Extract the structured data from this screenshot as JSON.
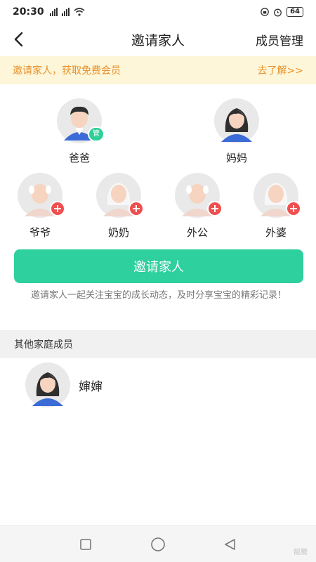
{
  "status_bar": {
    "time": "20:30",
    "battery": "64"
  },
  "header": {
    "title": "邀请家人",
    "right_action": "成员管理"
  },
  "promo": {
    "text": "邀请家人，获取免费会员",
    "link": "去了解>>"
  },
  "family_top": [
    {
      "name": "爸爸",
      "role": "father",
      "badge": "管"
    },
    {
      "name": "妈妈",
      "role": "mother"
    }
  ],
  "family_grand": [
    {
      "name": "爷爷",
      "role": "grandpa"
    },
    {
      "name": "奶奶",
      "role": "grandma"
    },
    {
      "name": "外公",
      "role": "grandpa"
    },
    {
      "name": "外婆",
      "role": "grandma"
    }
  ],
  "invite_button": "邀请家人",
  "invite_desc": "邀请家人一起关注宝宝的成长动态，及时分享宝宝的精彩记录！",
  "other_section": {
    "title": "其他家庭成员",
    "members": [
      {
        "name": "婶婶",
        "role": "aunt"
      }
    ]
  },
  "watermark": "龍騰",
  "colors": {
    "accent": "#2ed09d",
    "promo_text": "#e8902a",
    "promo_bg": "#fdf6d8",
    "plus_badge": "#ef4f4f"
  }
}
